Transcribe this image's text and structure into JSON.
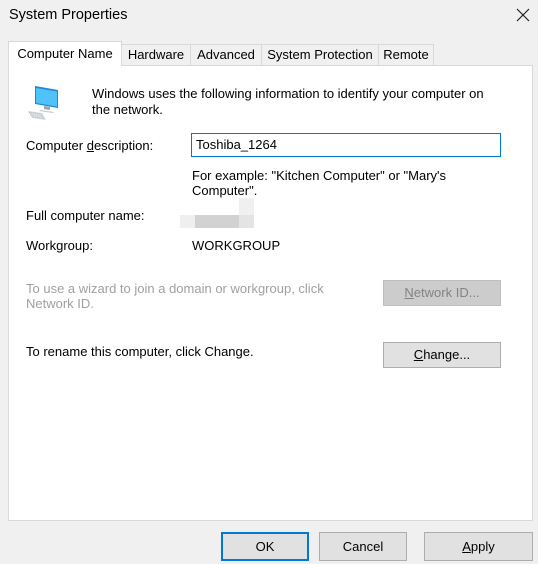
{
  "window": {
    "title": "System Properties",
    "close_icon": "close-icon"
  },
  "tabs": [
    {
      "label": "Computer Name",
      "active": true
    },
    {
      "label": "Hardware",
      "active": false
    },
    {
      "label": "Advanced",
      "active": false
    },
    {
      "label": "System Protection",
      "active": false
    },
    {
      "label": "Remote",
      "active": false
    }
  ],
  "computer_name": {
    "icon": "computer-icon",
    "intro_line1": "Windows uses the following information to identify your computer on",
    "intro_line2": "the network.",
    "description_label_pre": "Computer ",
    "description_label_accel": "d",
    "description_label_post": "escription:",
    "description_value": "Toshiba_1264",
    "example_line1": "For example: \"Kitchen Computer\" or \"Mary's",
    "example_line2": "Computer\".",
    "full_name_label": "Full computer name:",
    "full_name_value": "",
    "workgroup_label": "Workgroup:",
    "workgroup_value": "WORKGROUP",
    "wizard_text_line1": "To use a wizard to join a domain or workgroup, click",
    "wizard_text_line2": "Network ID.",
    "network_id_button": {
      "accel": "N",
      "rest": "etwork ID...",
      "enabled": false
    },
    "rename_text": "To rename this computer, click Change.",
    "change_button": {
      "accel": "C",
      "rest": "hange...",
      "enabled": true
    }
  },
  "footer": {
    "ok_label": "OK",
    "cancel_label": "Cancel",
    "apply_accel": "A",
    "apply_rest": "pply"
  },
  "colors": {
    "accent": "#0078d7",
    "disabled_text": "#838383"
  }
}
